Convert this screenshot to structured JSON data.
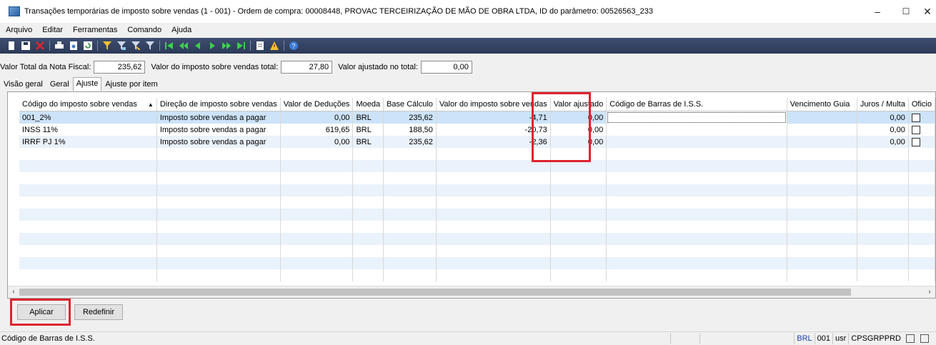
{
  "window": {
    "title": "Transações temporárias de imposto sobre vendas (1 - 001) - Ordem de compra: 00008448, PROVAC TERCEIRIZAÇÃO DE MÃO DE OBRA LTDA, ID do parâmetro: 00526563_233",
    "minimize": "–",
    "maximize": "☐",
    "close": "✕"
  },
  "menu": [
    "Arquivo",
    "Editar",
    "Ferramentas",
    "Comando",
    "Ajuda"
  ],
  "toolbar_icons": [
    "new-icon",
    "save-icon",
    "delete-icon",
    "print-icon",
    "print-preview-icon",
    "refresh-icon",
    "filter-by-selection-icon",
    "advanced-filter-icon",
    "filter-by-grid-icon",
    "filter-icon",
    "first-record-icon",
    "previous-page-icon",
    "previous-record-icon",
    "next-record-icon",
    "next-page-icon",
    "last-record-icon",
    "document-icon",
    "alert-icon",
    "help-icon"
  ],
  "totals": {
    "total_nf_label": "Valor Total da Nota Fiscal:",
    "total_nf_value": "235,62",
    "total_tax_label": "Valor do imposto sobre vendas total:",
    "total_tax_value": "27,80",
    "adjusted_label": "Valor ajustado no total:",
    "adjusted_value": "0,00"
  },
  "tabs": [
    "Visão geral",
    "Geral",
    "Ajuste",
    "Ajuste por item"
  ],
  "grid": {
    "columns": [
      "Código do imposto sobre vendas",
      "Direção de imposto sobre vendas",
      "Valor de Deduções",
      "Moeda",
      "Base Cálculo",
      "Valor do imposto sobre vendas",
      "Valor ajustado",
      "Código de Barras de I.S.S.",
      "Vencimento Guia",
      "Juros / Multa",
      "Oficio"
    ],
    "sort_indicator": "▲",
    "rows": [
      [
        "001_2%",
        "Imposto sobre vendas a pagar",
        "0,00",
        "BRL",
        "235,62",
        "-4,71",
        "0,00",
        "",
        "",
        "0,00"
      ],
      [
        "INSS 11%",
        "Imposto sobre vendas a pagar",
        "619,65",
        "BRL",
        "188,50",
        "-20,73",
        "0,00",
        "",
        "",
        "0,00"
      ],
      [
        "IRRF PJ 1%",
        "Imposto sobre vendas a pagar",
        "0,00",
        "BRL",
        "235,62",
        "-2,36",
        "0,00",
        "",
        "",
        "0,00"
      ]
    ],
    "empty_rows": 11
  },
  "scroll": {
    "left": "‹",
    "right": "›"
  },
  "buttons": {
    "apply": "Aplicar",
    "reset": "Redefinir"
  },
  "status": {
    "text": "Código de Barras de I.S.S.",
    "currency": "BRL",
    "company": "001",
    "user": "usr",
    "server": "CPSGRPPRD"
  },
  "colors": {
    "highlight": "#e0232e",
    "selected_row": "#cde3f8",
    "alt_row": "#eaf2fb",
    "toolbar": "#2c3a58"
  }
}
